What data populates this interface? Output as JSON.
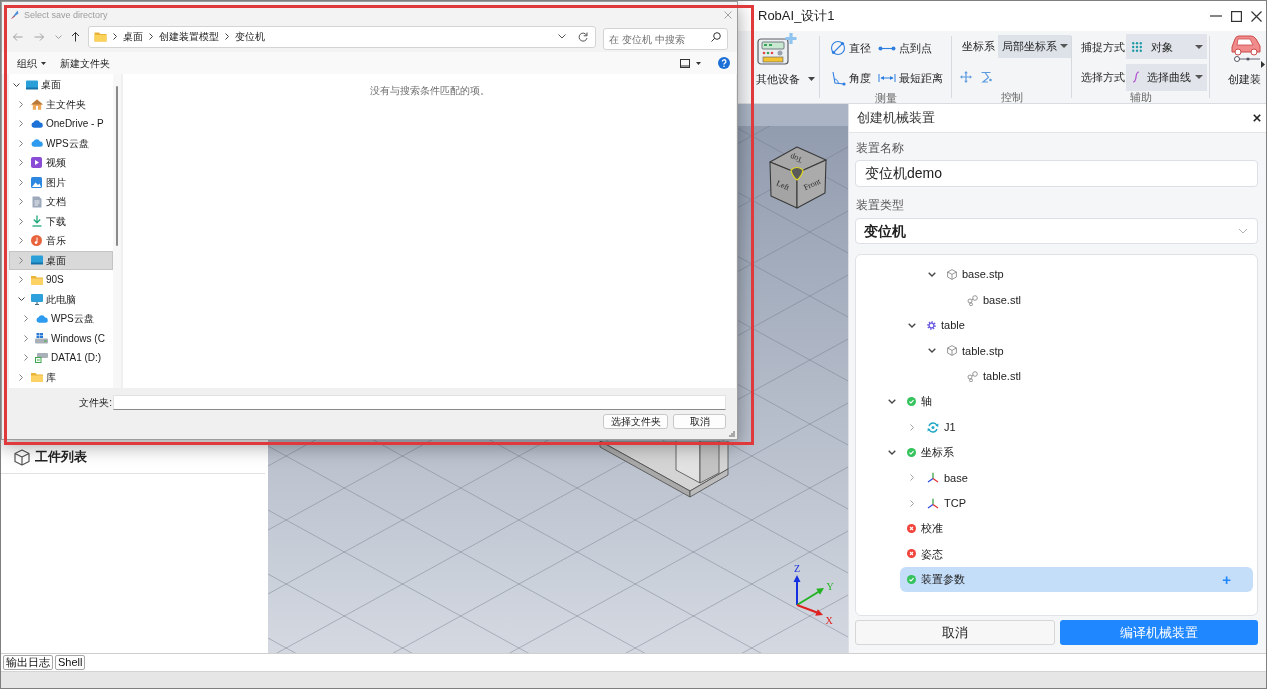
{
  "app_window": {
    "title": "RobAI_设计1"
  },
  "ribbon": {
    "device_button": {
      "label": "其他设备"
    },
    "measure_group": {
      "title": "测量",
      "tools": [
        {
          "kind": "diameter",
          "label": "直径"
        },
        {
          "kind": "point_to_point",
          "label": "点到点"
        },
        {
          "kind": "angle",
          "label": "角度"
        },
        {
          "kind": "shortest_distance",
          "label": "最短距离"
        }
      ]
    },
    "control_group": {
      "title": "控制",
      "coordinate_label": "坐标系",
      "coordinate_value": "局部坐标系"
    },
    "assist_group": {
      "title": "辅助",
      "snap_label": "捕捉方式",
      "snap_value": "对象",
      "select_label": "选择方式",
      "select_value": "选择曲线"
    },
    "create_button": {
      "label": "创建装"
    }
  },
  "dialog": {
    "title": "Select save directory",
    "path": [
      "桌面",
      "创建装置模型",
      "变位机"
    ],
    "search": {
      "placeholder": "在 变位机 中搜索"
    },
    "commands": [
      {
        "label": "组织",
        "has_menu": true
      },
      {
        "label": "新建文件夹",
        "has_menu": false
      }
    ],
    "nav_tree": [
      {
        "kind": "desktop",
        "label": "桌面",
        "expanded": true,
        "selected": false,
        "children": [
          {
            "kind": "home",
            "label": "主文件夹",
            "expanded": false,
            "selected": false
          },
          {
            "kind": "onedrive",
            "label": "OneDrive - P",
            "expanded": false,
            "selected": false
          },
          {
            "kind": "cloud",
            "label": "WPS云盘",
            "expanded": false,
            "selected": false
          },
          {
            "kind": "video",
            "label": "视频",
            "expanded": false,
            "selected": false
          },
          {
            "kind": "picture",
            "label": "图片",
            "expanded": false,
            "selected": false
          },
          {
            "kind": "document",
            "label": "文档",
            "expanded": false,
            "selected": false
          },
          {
            "kind": "download",
            "label": "下载",
            "expanded": false,
            "selected": false
          },
          {
            "kind": "music",
            "label": "音乐",
            "expanded": false,
            "selected": false
          },
          {
            "kind": "desktop",
            "label": "桌面",
            "expanded": false,
            "selected": true
          },
          {
            "kind": "folder",
            "label": "90S",
            "expanded": false,
            "selected": false
          },
          {
            "kind": "computer",
            "label": "此电脑",
            "expanded": true,
            "selected": false,
            "children": [
              {
                "kind": "cloud",
                "label": "WPS云盘",
                "expanded": false,
                "selected": false
              },
              {
                "kind": "system_drive",
                "label": "Windows (C",
                "expanded": false,
                "selected": false
              },
              {
                "kind": "drive",
                "label": "DATA1 (D:)",
                "expanded": false,
                "selected": false
              }
            ]
          },
          {
            "kind": "folder",
            "label": "库",
            "expanded": false,
            "selected": false
          }
        ]
      }
    ],
    "empty_message": "没有与搜索条件匹配的项。",
    "folder_label": "文件夹:",
    "buttons": [
      {
        "kind": "confirm",
        "label": "选择文件夹"
      },
      {
        "kind": "cancel",
        "label": "取消"
      }
    ]
  },
  "workpiece_panel": {
    "title": "工件列表"
  },
  "viewport": {
    "view_cube": {
      "top": "Top",
      "left": "Left",
      "front": "Front"
    },
    "axes": {
      "x": "X",
      "y": "Y",
      "z": "Z"
    }
  },
  "device_panel": {
    "title": "创建机械装置",
    "name_label": "装置名称",
    "name_value": "变位机demo",
    "type_label": "装置类型",
    "type_value": "变位机",
    "tree": [
      {
        "children": [
          {
            "children": [
              {
                "kind": "stp",
                "label": "base.stp",
                "expanded": true,
                "selected": false,
                "children": [
                  {
                    "kind": "stl",
                    "label": "base.stl",
                    "selected": false
                  }
                ]
              }
            ]
          },
          {
            "kind": "link",
            "label": "table",
            "expanded": true,
            "selected": false,
            "children": [
              {
                "kind": "stp",
                "label": "table.stp",
                "expanded": true,
                "selected": false,
                "children": [
                  {
                    "kind": "stl",
                    "label": "table.stl",
                    "selected": false
                  }
                ]
              }
            ]
          }
        ]
      },
      {
        "kind": "status",
        "valid": true,
        "label": "轴",
        "expanded": true,
        "selected": false,
        "children": [
          {
            "kind": "joint",
            "label": "J1",
            "expanded": false,
            "selected": false
          }
        ]
      },
      {
        "kind": "status",
        "valid": true,
        "label": "坐标系",
        "expanded": true,
        "selected": false,
        "children": [
          {
            "kind": "frame",
            "label": "base",
            "expanded": false,
            "selected": false
          },
          {
            "kind": "frame",
            "label": "TCP",
            "expanded": false,
            "selected": false
          }
        ]
      },
      {
        "kind": "status",
        "valid": false,
        "label": "校准",
        "selected": false
      },
      {
        "kind": "status",
        "valid": false,
        "label": "姿态",
        "selected": false
      },
      {
        "kind": "status",
        "valid": true,
        "label": "装置参数",
        "selected": true,
        "action": "+"
      }
    ],
    "buttons": [
      {
        "kind": "cancel",
        "label": "取消"
      },
      {
        "kind": "compile",
        "label": "编译机械装置"
      }
    ]
  },
  "bottom_tabs": [
    {
      "label": "输出日志"
    },
    {
      "label": "Shell"
    }
  ]
}
